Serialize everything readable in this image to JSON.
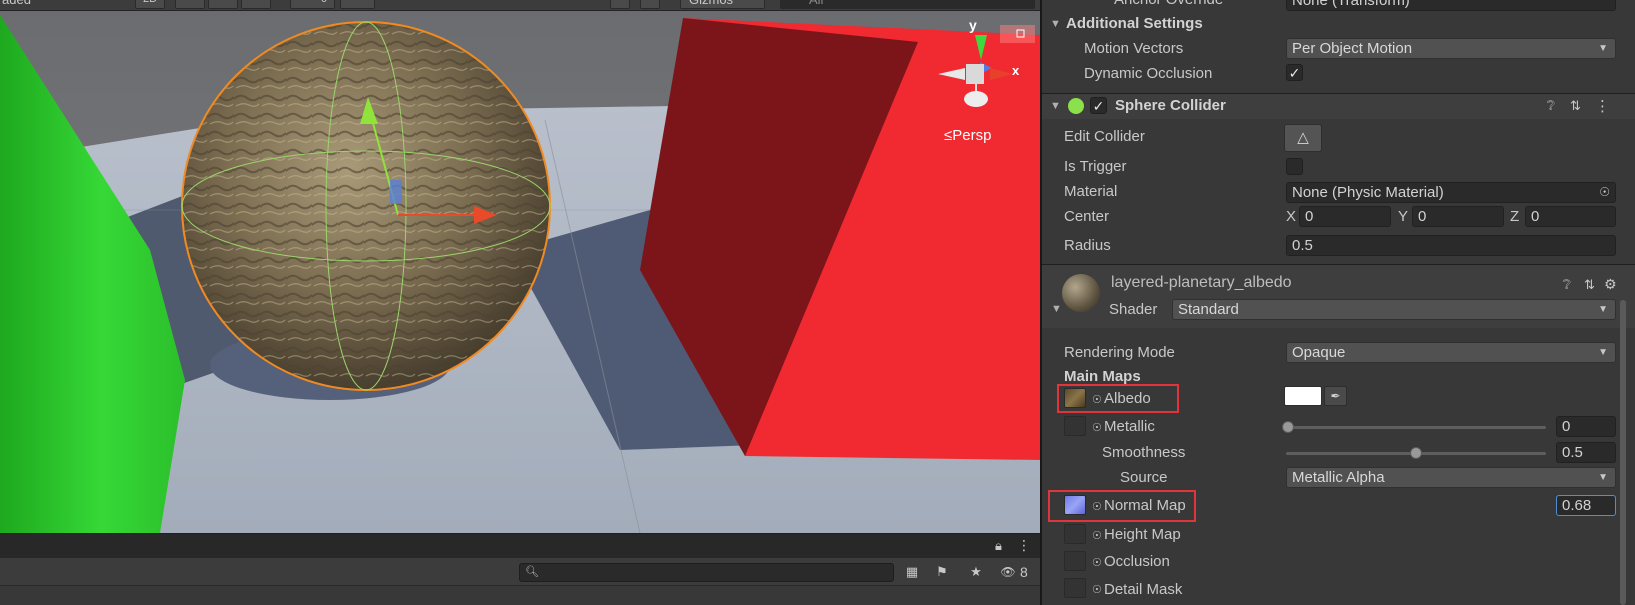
{
  "scene_view": {
    "toolbar": {
      "draw_mode": "aded",
      "mode_2d": "2D",
      "gizmos": "Gizmos",
      "search_placeholder": "All",
      "fx_count": "0"
    },
    "gizmo": {
      "axis_y": "y",
      "axis_x": "x",
      "projection": "≤Persp"
    }
  },
  "bottom_panel": {
    "hidden_count": "8",
    "search_placeholder": ""
  },
  "inspector": {
    "anchor_override": {
      "label": "Anchor Override",
      "value": "None (Transform)"
    },
    "additional_settings": {
      "label": "Additional Settings",
      "motion_vectors": {
        "label": "Motion Vectors",
        "value": "Per Object Motion"
      },
      "dynamic_occlusion": {
        "label": "Dynamic Occlusion",
        "checked": true
      }
    },
    "sphere_collider": {
      "title": "Sphere Collider",
      "enabled": true,
      "edit_collider": {
        "label": "Edit Collider"
      },
      "is_trigger": {
        "label": "Is Trigger",
        "checked": false
      },
      "material": {
        "label": "Material",
        "value": "None (Physic Material)"
      },
      "center": {
        "label": "Center",
        "x_label": "X",
        "x": "0",
        "y_label": "Y",
        "y": "0",
        "z_label": "Z",
        "z": "0"
      },
      "radius": {
        "label": "Radius",
        "value": "0.5"
      }
    },
    "material": {
      "name": "layered-planetary_albedo",
      "shader_label": "Shader",
      "shader_value": "Standard",
      "rendering_mode": {
        "label": "Rendering Mode",
        "value": "Opaque"
      },
      "main_maps_label": "Main Maps",
      "albedo": {
        "label": "Albedo",
        "color": "#ffffff"
      },
      "metallic": {
        "label": "Metallic",
        "value": "0",
        "fraction": 0.0
      },
      "smoothness": {
        "label": "Smoothness",
        "value": "0.5",
        "fraction": 0.5
      },
      "source": {
        "label": "Source",
        "value": "Metallic Alpha"
      },
      "normal_map": {
        "label": "Normal Map",
        "value": "0.68"
      },
      "height_map": {
        "label": "Height Map"
      },
      "occlusion": {
        "label": "Occlusion"
      },
      "detail_mask": {
        "label": "Detail Mask"
      }
    }
  },
  "colors": {
    "highlight": "#e0353a",
    "cone": "#2fcf2f",
    "cube": "#e8242a",
    "selection_outline": "#f08a22"
  }
}
